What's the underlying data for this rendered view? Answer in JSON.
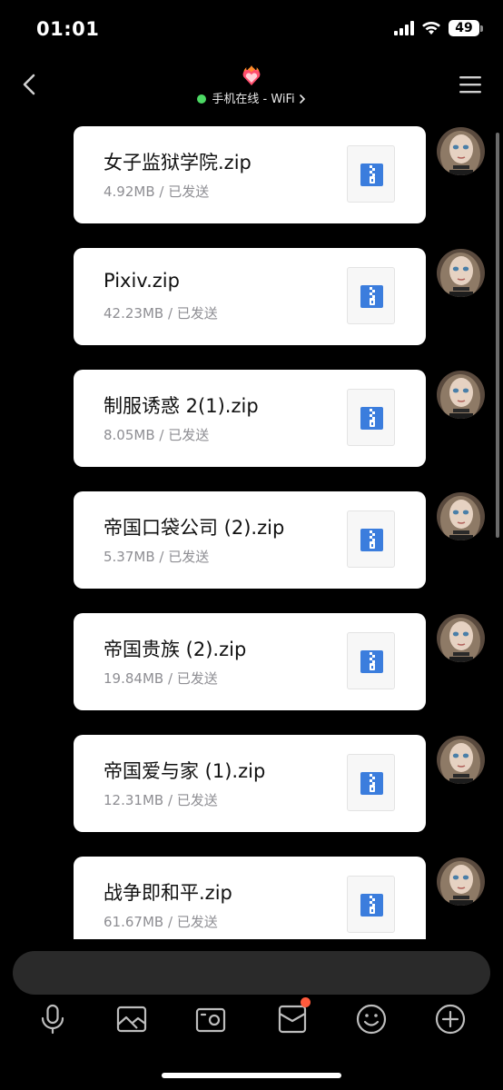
{
  "status_bar": {
    "time": "01:01",
    "battery": "49"
  },
  "header": {
    "presence_text": "手机在线 - WiFi",
    "icons": [
      "back-icon",
      "heart-fire-icon",
      "menu-icon"
    ],
    "online_color": "#4cd964"
  },
  "messages": [
    {
      "file_name": "女子监狱学院.zip",
      "meta": "4.92MB / 已发送"
    },
    {
      "file_name": "Pixiv.zip",
      "meta": "42.23MB / 已发送"
    },
    {
      "file_name": "制服诱惑 2(1).zip",
      "meta": "8.05MB / 已发送"
    },
    {
      "file_name": "帝国口袋公司 (2).zip",
      "meta": "5.37MB / 已发送"
    },
    {
      "file_name": "帝国贵族 (2).zip",
      "meta": "19.84MB / 已发送"
    },
    {
      "file_name": "帝国爱与家 (1).zip",
      "meta": "12.31MB / 已发送"
    },
    {
      "file_name": "战争即和平.zip",
      "meta": "61.67MB / 已发送"
    }
  ],
  "toolbar": {
    "items": [
      "microphone-icon",
      "image-icon",
      "camera-icon",
      "red-packet-icon",
      "emoji-icon",
      "plus-icon"
    ],
    "badge_color": "#ff5a3c"
  },
  "colors": {
    "background": "#000000",
    "card": "#ffffff",
    "zip_blue": "#3b7ddd",
    "meta_gray": "#8e8e93"
  }
}
